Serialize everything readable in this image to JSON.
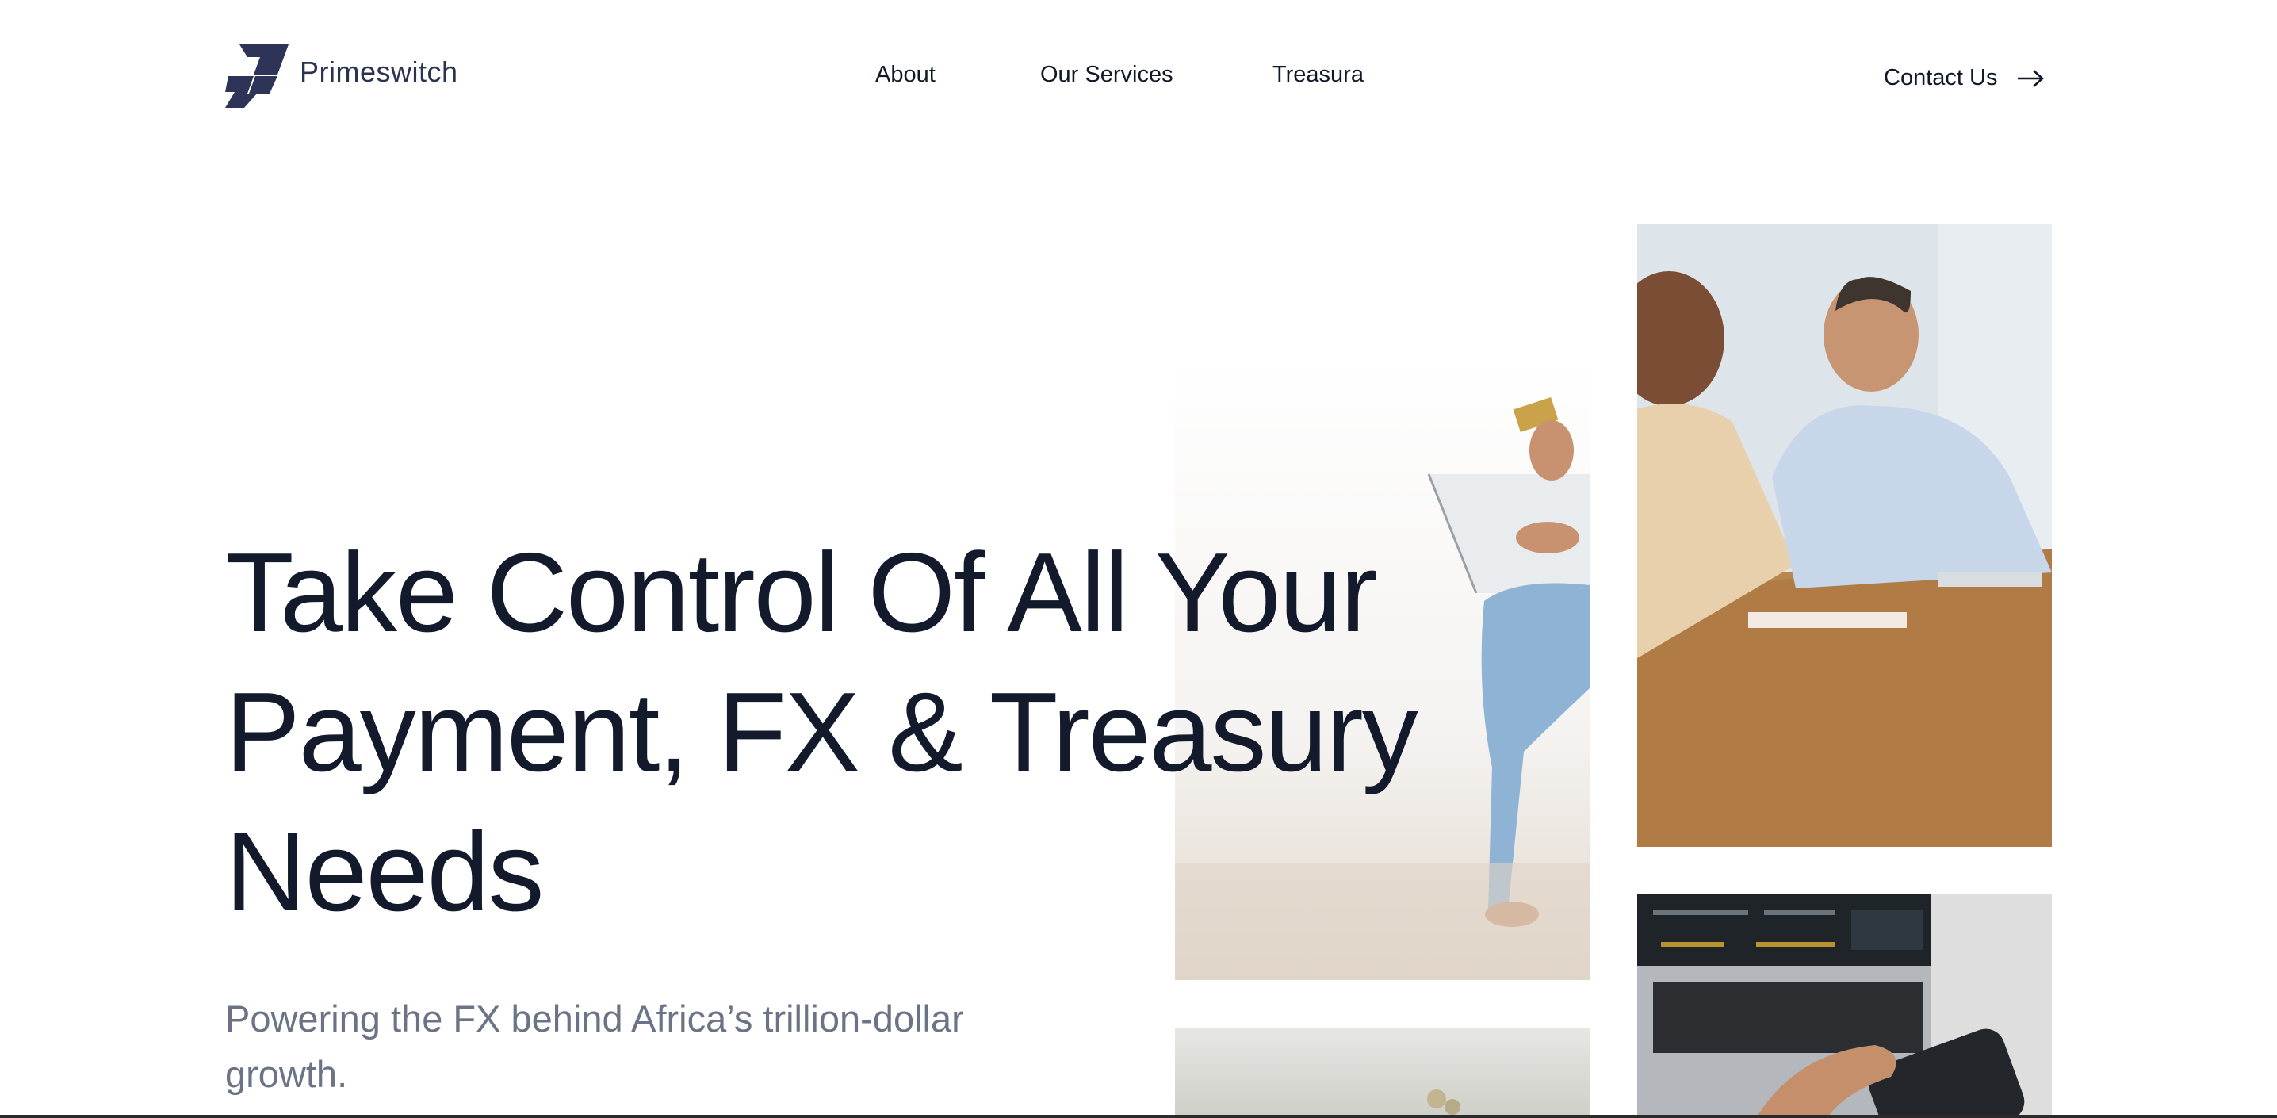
{
  "header": {
    "brand": "Primeswitch",
    "nav": [
      "About",
      "Our Services",
      "Treasura"
    ],
    "contact_label": "Contact Us"
  },
  "hero": {
    "title": "Take Control Of All Your Payment, FX & Treasury Needs",
    "subtitle": "Powering the FX behind Africa’s trillion-dollar growth."
  },
  "colors": {
    "brand": "#2a3350",
    "heading": "#121a2b",
    "subtitle": "#6b7386"
  },
  "images": [
    "photo-person-with-laptop-and-card",
    "photo-business-meeting",
    "photo-desk-objects",
    "photo-laptop-and-phone-trading"
  ]
}
